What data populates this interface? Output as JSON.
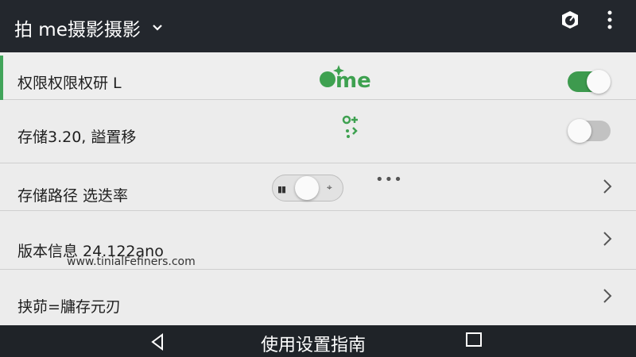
{
  "appbar": {
    "title": "拍 me摄影摄影"
  },
  "rows": [
    {
      "label": "权限权限权研 L",
      "logo": "me",
      "toggle": "on"
    },
    {
      "label": "存储3.20, 謚置移",
      "toggle": "off"
    },
    {
      "label": "存储路径 选迭率"
    },
    {
      "label": "版本信息 24.122ano",
      "sub": "www.tinialFefiners.com"
    },
    {
      "label": "挟茆=牗存元刃"
    }
  ],
  "navbar": {
    "guide": "使用设置指南"
  },
  "colors": {
    "accent": "#3d9a4e",
    "bar": "#23272d",
    "panel": "#ececec"
  }
}
